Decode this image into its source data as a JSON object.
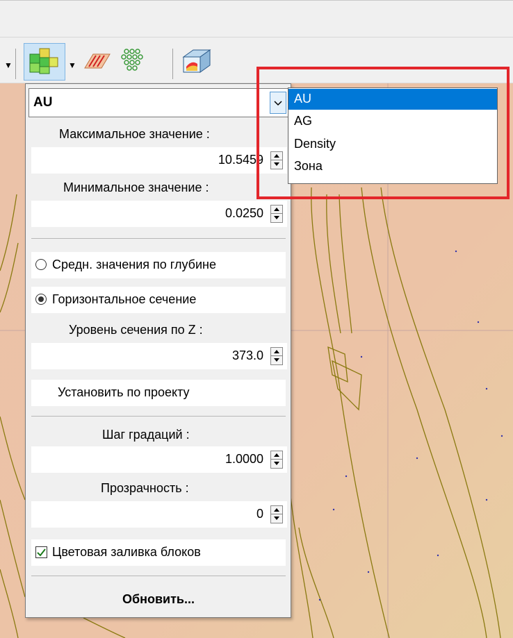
{
  "toolbar": {
    "icons": [
      "block-model-icon",
      "layers-icon",
      "points-icon",
      "3d-box-icon"
    ]
  },
  "panel": {
    "combo_value": "AU",
    "max_label": "Максимальное значение :",
    "max_value": "10.5459",
    "min_label": "Минимальное значение :",
    "min_value": "0.0250",
    "radio_avg": "Средн. значения по глубине",
    "radio_horizontal": "Горизонтальное сечение",
    "z_label": "Уровень сечения по Z :",
    "z_value": "373.0",
    "set_by_project": "Установить по проекту",
    "step_label": "Шаг градаций :",
    "step_value": "1.0000",
    "transparency_label": "Прозрачность :",
    "transparency_value": "0",
    "fill_checkbox": "Цветовая заливка блоков",
    "refresh_button": "Обновить..."
  },
  "dropdown": {
    "options": [
      "AU",
      "AG",
      "Density",
      "Зона"
    ],
    "selected": "AU"
  },
  "colors": {
    "accent": "#0078d7",
    "highlight": "#e3262b",
    "map_tan": "#e9c0a4"
  }
}
